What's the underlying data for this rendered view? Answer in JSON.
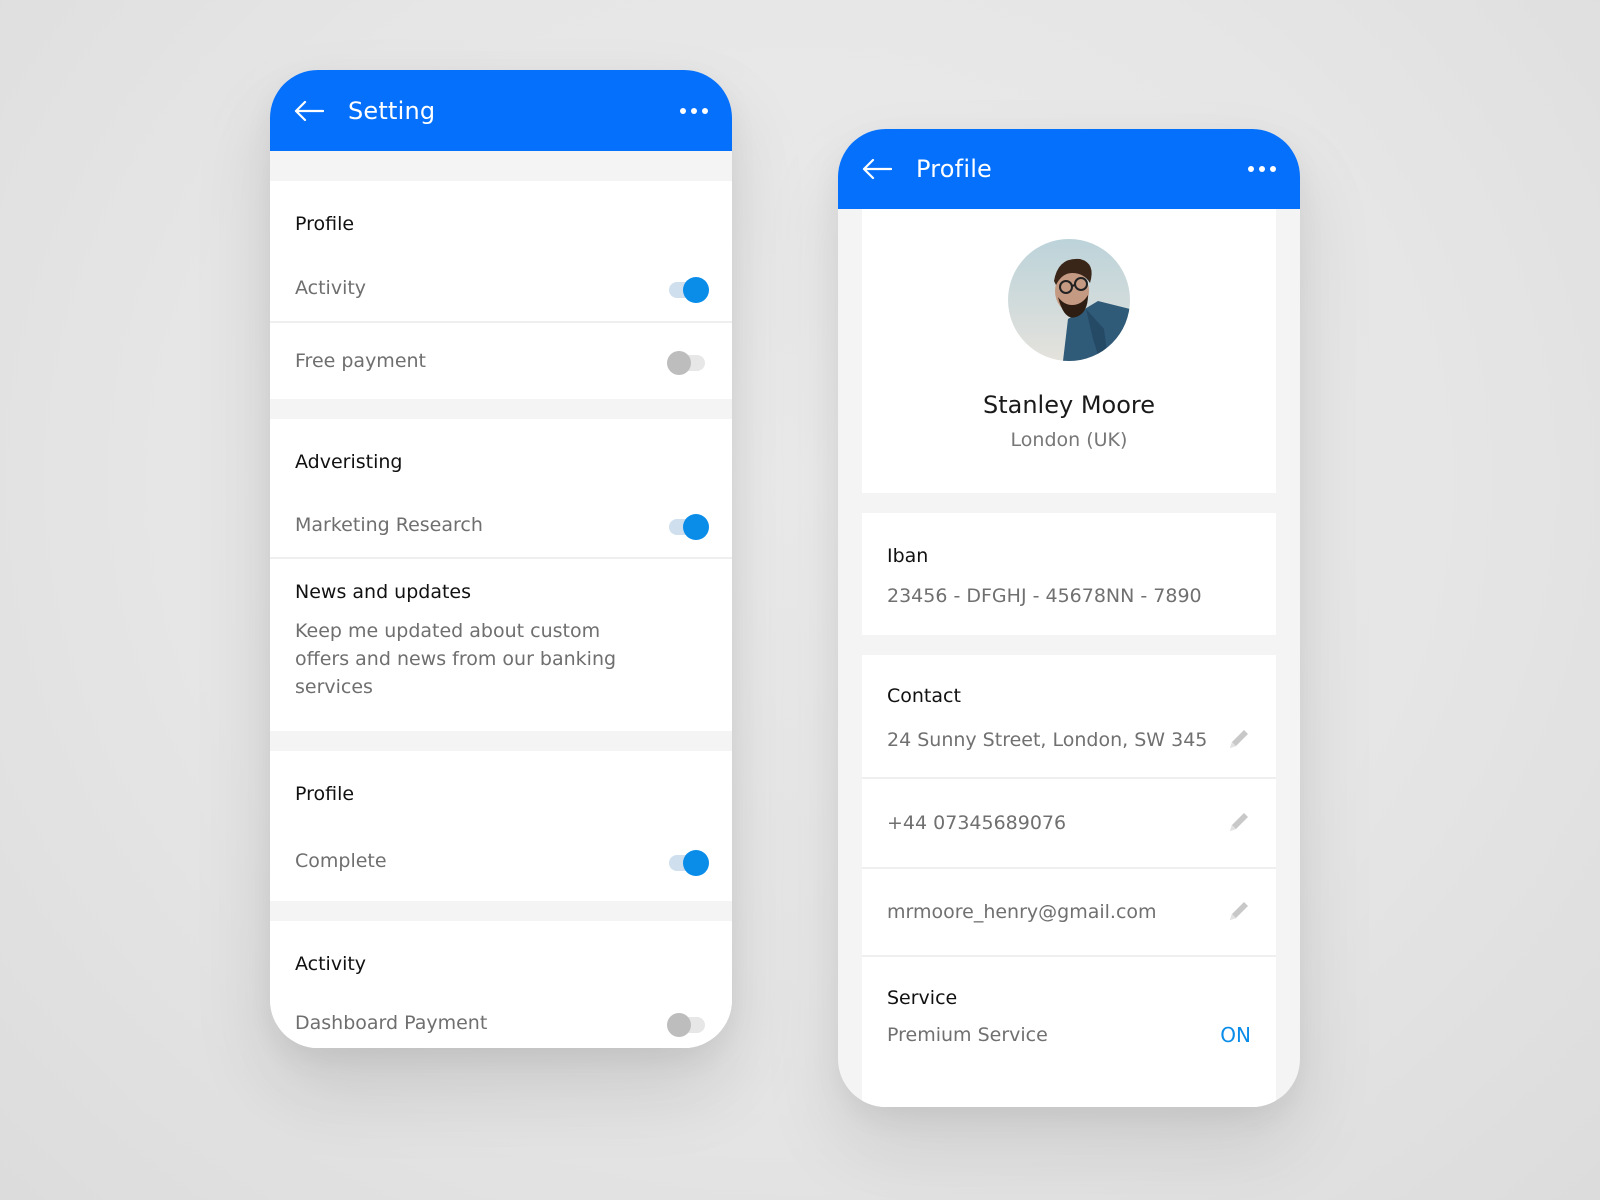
{
  "settings_screen": {
    "title": "Setting",
    "back_icon": "arrow-left-icon",
    "more_icon": "more-horizontal-icon",
    "sections": [
      {
        "title": "Profile",
        "items": [
          {
            "label": "Activity",
            "toggle": true
          },
          {
            "label": "Free payment",
            "toggle": false
          }
        ]
      },
      {
        "title": "Adveristing",
        "items": [
          {
            "label": "Marketing Research",
            "toggle": true
          }
        ],
        "news": {
          "title": "News and updates",
          "description": "Keep me updated about custom offers and news from our banking services"
        }
      },
      {
        "title": "Profile",
        "items": [
          {
            "label": "Complete",
            "toggle": true
          }
        ]
      },
      {
        "title": "Activity",
        "items": [
          {
            "label": "Dashboard Payment",
            "toggle": false
          }
        ]
      }
    ]
  },
  "profile_screen": {
    "title": "Profile",
    "back_icon": "arrow-left-icon",
    "more_icon": "more-horizontal-icon",
    "user": {
      "name": "Stanley Moore",
      "location": "London (UK)",
      "avatar_icon": "user-photo-avatar"
    },
    "iban": {
      "title": "Iban",
      "value": "23456 - DFGHJ - 45678NN - 7890"
    },
    "contact": {
      "title": "Contact",
      "items": [
        {
          "value": "24 Sunny Street, London, SW 345",
          "icon": "pencil-icon"
        },
        {
          "value": "+44 07345689076",
          "icon": "pencil-icon"
        },
        {
          "value": "mrmoore_henry@gmail.com",
          "icon": "pencil-icon"
        }
      ]
    },
    "service": {
      "title": "Service",
      "label": "Premium Service",
      "status": "ON"
    }
  },
  "colors": {
    "primary": "#0570fb",
    "toggle_on": "#0a8ce9",
    "toggle_on_track": "#cfdfee",
    "toggle_off": "#bdbdbd",
    "toggle_off_track": "#e7e7e7",
    "status_on": "#0a8ce9"
  }
}
